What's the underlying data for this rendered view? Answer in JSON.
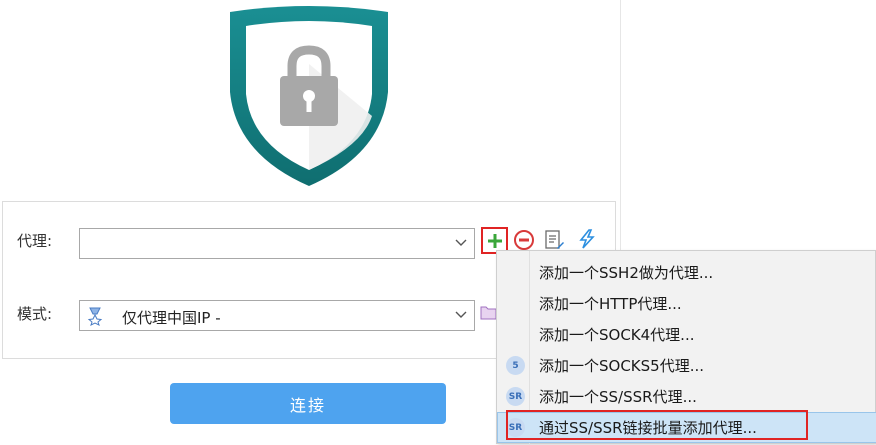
{
  "form": {
    "proxy_label": "代理:",
    "proxy_value": "",
    "mode_label": "模式:",
    "mode_value": "仅代理中国IP -"
  },
  "connect_label": "连接",
  "menu": {
    "items": [
      {
        "label": "添加一个SSH2做为代理...",
        "icon": ""
      },
      {
        "label": "添加一个HTTP代理...",
        "icon": ""
      },
      {
        "label": "添加一个SOCK4代理...",
        "icon": ""
      },
      {
        "label": "添加一个SOCKS5代理...",
        "icon": "5"
      },
      {
        "label": "添加一个SS/SSR代理...",
        "icon": "SR"
      },
      {
        "label": "通过SS/SSR链接批量添加代理...",
        "icon": "SR"
      }
    ]
  },
  "colors": {
    "shield": "#1a8c8f",
    "lock": "#a8a8a8",
    "accent_button": "#4ea3ef",
    "highlight": "#e02424",
    "menu_selected": "#cde4f7"
  }
}
